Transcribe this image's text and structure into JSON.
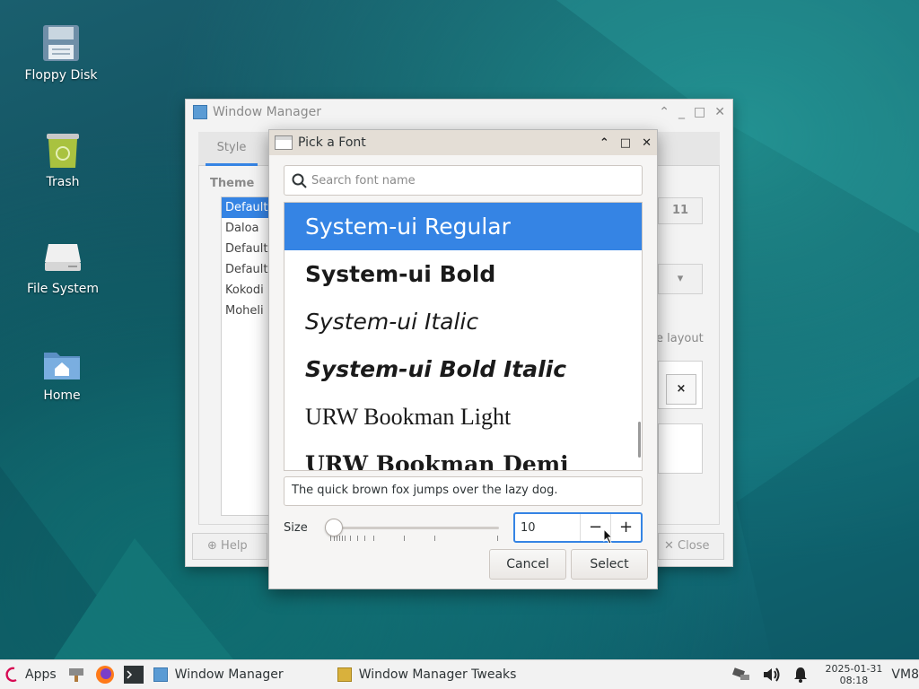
{
  "colors": {
    "accent": "#3584e4",
    "desktop_bg": "#14606e",
    "dialog_title_bg": "#e4ded6"
  },
  "desktop": {
    "icons": [
      {
        "label": "Floppy Disk",
        "icon": "floppy-disk-icon"
      },
      {
        "label": "Trash",
        "icon": "trash-icon"
      },
      {
        "label": "File System",
        "icon": "drive-icon"
      },
      {
        "label": "Home",
        "icon": "home-folder-icon"
      }
    ]
  },
  "wm_window": {
    "title": "Window Manager",
    "tab": "Style",
    "theme_label": "Theme",
    "themes": [
      "Default",
      "Daloa",
      "Default",
      "Default",
      "Kokodi",
      "Moheli"
    ],
    "spin_value": "11",
    "layout_label": "e layout",
    "x_label": "×",
    "help_label": "Help",
    "close_label": "Close"
  },
  "font_dialog": {
    "title": "Pick a Font",
    "search_placeholder": "Search font name",
    "fonts": [
      "System-ui Regular",
      "System-ui Bold",
      "System-ui Italic",
      "System-ui Bold Italic",
      "URW Bookman Light",
      "URW Bookman Demi"
    ],
    "selected_font": "System-ui Regular",
    "preview_text": "The quick brown fox jumps over the lazy dog.",
    "size_label": "Size",
    "size_value": "10",
    "minus_label": "−",
    "plus_label": "+",
    "cancel_label": "Cancel",
    "select_label": "Select"
  },
  "taskbar": {
    "apps_label": "Apps",
    "tasks": [
      "Window Manager",
      "Window Manager Tweaks"
    ],
    "date": "2025-01-31",
    "time": "08:18",
    "user": "VM8"
  }
}
